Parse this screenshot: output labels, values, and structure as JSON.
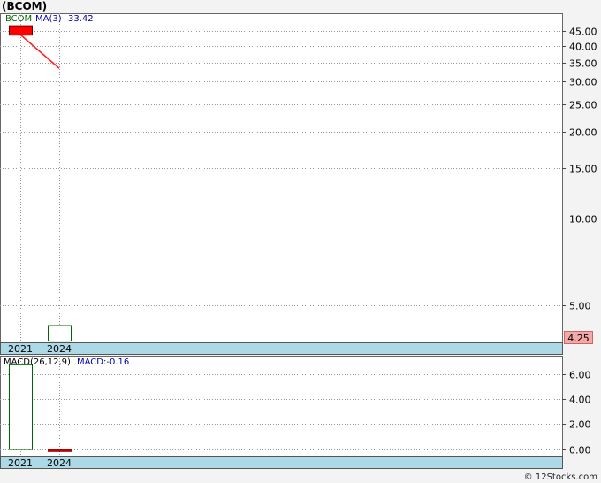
{
  "title": "(BCOM)",
  "footer": "© 12Stocks.com",
  "chart_data": [
    {
      "type": "candlestick",
      "scale": "log",
      "legend": {
        "symbol": "BCOM",
        "ma_label": "MA(3)",
        "ma_value": "33.42"
      },
      "categories": [
        "2021",
        "2024"
      ],
      "candles": [
        {
          "x": "2021",
          "open": 47.2,
          "close": 43.8,
          "high": 47.2,
          "low": 43.8,
          "color": "#ff0000"
        },
        {
          "x": "2024",
          "open": 3.75,
          "close": 4.25,
          "high": 4.25,
          "low": 3.75,
          "color": "#ffffff"
        }
      ],
      "ma": {
        "label": "MA(3)",
        "points": [
          [
            "2021",
            43.8
          ],
          [
            "2024",
            33.42
          ]
        ],
        "color": "#ff2222"
      },
      "yticks": [
        5,
        10,
        15,
        20,
        25,
        30,
        35,
        40,
        45
      ],
      "ytick_labels": [
        "5.00",
        "10.00",
        "15.00",
        "20.00",
        "25.00",
        "30.00",
        "35.00",
        "40.00",
        "45.00"
      ],
      "last_price": "4.25",
      "ylim": [
        3.7,
        52
      ]
    },
    {
      "type": "bar",
      "legend": {
        "label": "MACD(26,12,9)",
        "value_label": "MACD:-0.16"
      },
      "categories": [
        "2021",
        "2024"
      ],
      "values": [
        6.8,
        -0.16
      ],
      "colors": [
        "#ffffff",
        "#cc0000"
      ],
      "yticks": [
        0,
        2,
        4,
        6
      ],
      "ytick_labels": [
        "0.00",
        "2.00",
        "4.00",
        "6.00"
      ],
      "ylim": [
        -0.6,
        7.5
      ]
    }
  ]
}
